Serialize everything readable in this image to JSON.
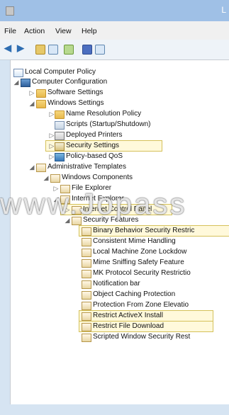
{
  "window": {
    "title": "L"
  },
  "menubar": {
    "items": [
      "File",
      "Action",
      "View",
      "Help"
    ]
  },
  "toolbar": {
    "icons": [
      "back-icon",
      "forward-icon",
      "up-folder-icon",
      "show-hide-tree-icon",
      "export-list-icon",
      "help-icon",
      "properties-icon"
    ]
  },
  "tree": {
    "root": "Local Computer Policy",
    "computer_configuration": "Computer Configuration",
    "software_settings": "Software Settings",
    "windows_settings": "Windows Settings",
    "name_resolution_policy": "Name Resolution Policy",
    "scripts": "Scripts (Startup/Shutdown)",
    "deployed_printers": "Deployed Printers",
    "security_settings": "Security Settings",
    "policy_based_qos": "Policy-based QoS",
    "administrative_templates": "Administrative Templates",
    "windows_components": "Windows Components",
    "file_explorer": "File Explorer",
    "internet_explorer": "Internet Explorer",
    "internet_control_panel": "Internet Control Panel",
    "security_features": "Security Features",
    "features": [
      "Binary Behavior Security Restric",
      "Consistent Mime Handling",
      "Local Machine Zone Lockdow",
      "Mime Sniffing Safety Feature",
      "MK Protocol Security Restrictio",
      "Notification bar",
      "Object Caching Protection",
      "Protection From Zone Elevatio",
      "Restrict ActiveX Install",
      "Restrict File Download",
      "Scripted Window Security Rest"
    ]
  },
  "watermark": "www.Jopass"
}
